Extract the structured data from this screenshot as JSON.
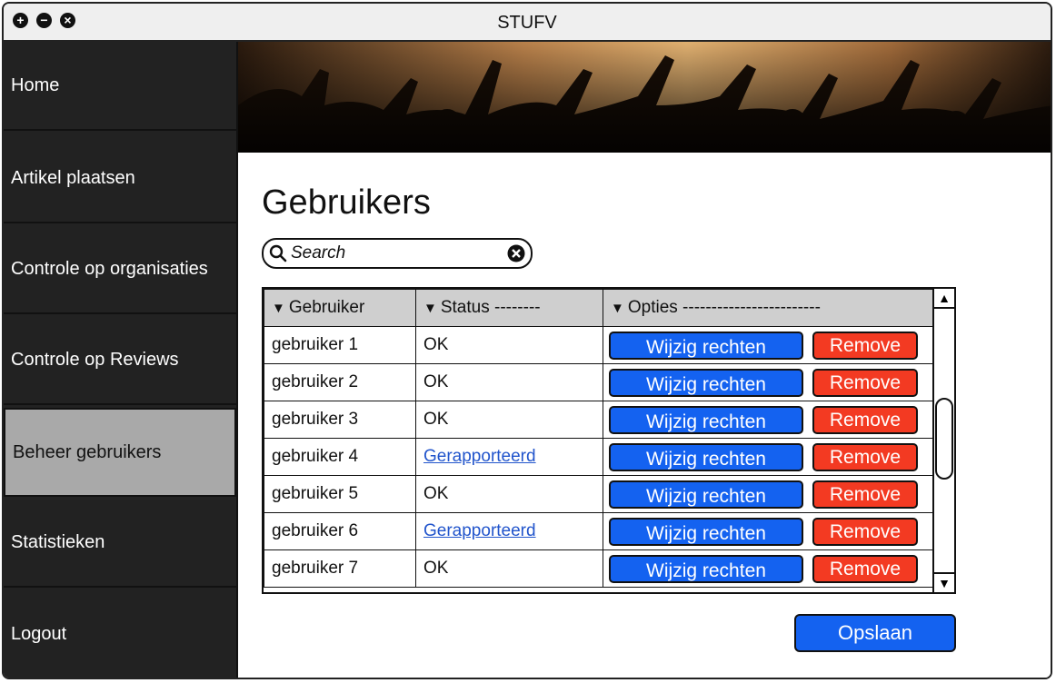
{
  "window": {
    "title": "STUFV"
  },
  "sidebar": {
    "items": [
      {
        "label": "Home"
      },
      {
        "label": "Artikel plaatsen"
      },
      {
        "label": "Controle op organisaties"
      },
      {
        "label": "Controle op Reviews"
      },
      {
        "label": "Beheer gebruikers",
        "active": true
      },
      {
        "label": "Statistieken"
      },
      {
        "label": "Logout"
      }
    ]
  },
  "main": {
    "title": "Gebruikers",
    "search": {
      "placeholder": "Search"
    },
    "table": {
      "headers": [
        "Gebruiker",
        "Status --------",
        "Opties ------------------------"
      ],
      "rows": [
        {
          "user": "gebruiker 1",
          "status": "OK"
        },
        {
          "user": "gebruiker 2",
          "status": "OK"
        },
        {
          "user": "gebruiker 3",
          "status": "OK"
        },
        {
          "user": "gebruiker 4",
          "status": "Gerapporteerd"
        },
        {
          "user": "gebruiker 5",
          "status": "OK"
        },
        {
          "user": "gebruiker 6",
          "status": "Gerapporteerd"
        },
        {
          "user": "gebruiker 7",
          "status": "OK"
        }
      ],
      "edit_label": "Wijzig rechten",
      "remove_label": "Remove"
    },
    "save_label": "Opslaan"
  },
  "colors": {
    "primary": "#1462f0",
    "danger": "#f33a22",
    "sidebar": "#222222",
    "active": "#a9a9a9",
    "link": "#2255cc"
  }
}
